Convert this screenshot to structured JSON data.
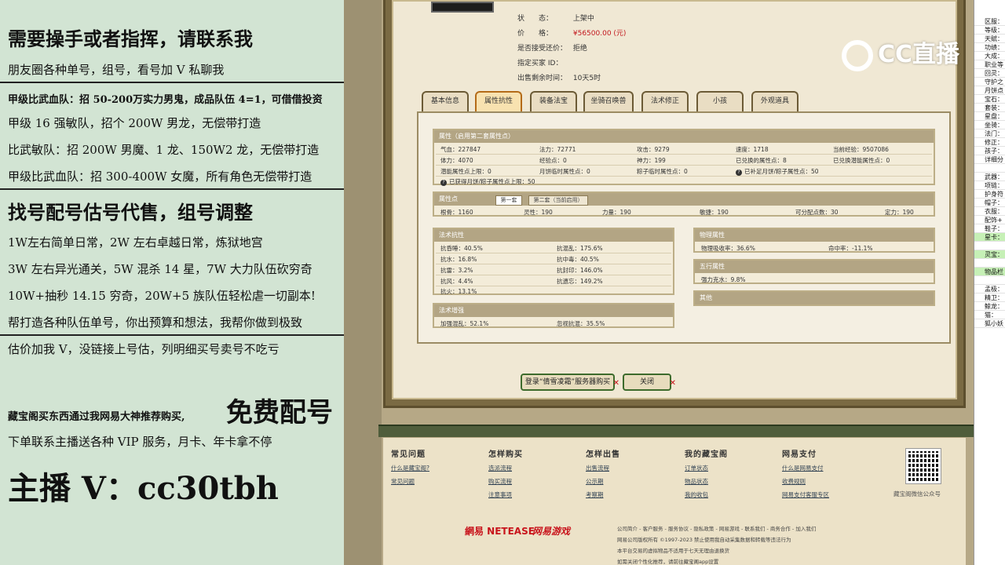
{
  "left_panel": {
    "lines": [
      "需要操手或者指挥，请联系我",
      "朋友圈各种单号，组号，看号加 V 私聊我",
      "甲级比武血队：招 50-200万实力男鬼，成品队伍 4=1，可借借投资",
      "甲级 16 强敏队，招个 200W 男龙，无偿带打造",
      "比武敏队：招 200W 男魔、1 龙、150W2 龙，无偿带打造",
      "甲级比武血队：招 300-400W 女魔，所有角色无偿带打造",
      "找号配号估号代售，组号调整",
      "1W左右简单日常，2W 左右卓越日常，炼狱地宫",
      "3W 左右异光通关，5W 混杀 14 星，7W 大力队伍砍穷奇",
      "10W+抽秒 14.15 穷奇，20W+5 族队伍轻松虐一切副本!",
      "帮打造各种队伍单号，你出预算和想法，我帮你做到极致",
      "估价加我 V，没链接上号估，列明细买号卖号不吃亏",
      "藏宝阁买东西通过我网易大神推荐购买,",
      "免费配号",
      "下单联系主播送各种 VIP 服务，月卡、年卡拿不停",
      "主播 V：cc30tbh"
    ]
  },
  "listing": {
    "status_label": "状　　态：",
    "status_value": "上架中",
    "price_label": "价　　格：",
    "price_value": "¥56500.00 (元)",
    "bargain_label": "是否接受还价：",
    "bargain_value": "拒绝",
    "buyer_label": "指定买家 ID：",
    "remain_label": "出售剩余时间：",
    "remain_value": "10天5时"
  },
  "tabs": [
    "基本信息",
    "属性抗性",
    "装备法宝",
    "坐骑召唤兽",
    "法术修正",
    "小孩",
    "外观道具"
  ],
  "attr": {
    "header": "属性（启用第二套属性点）",
    "row1": [
      "气血：227847",
      "法力：72771",
      "攻击：9279",
      "速度：1718",
      "当前经验：9507086"
    ],
    "row2": [
      "体力：4070",
      "经验点：0",
      "神力：199",
      "已兑换的属性点：8",
      "已兑换潜能属性点：0"
    ],
    "row3": [
      "潜能属性点上限：0",
      "月饼临时属性点：0",
      "粽子临时属性点：0",
      "已补足月饼/粽子属性点：50"
    ],
    "row4": "已获得月饼/粽子属性点上限：50"
  },
  "points": {
    "header": "属性点",
    "subtab1": "第一套",
    "subtab2": "第二套（当前启用）",
    "values": [
      "根骨：1160",
      "灵性：190",
      "力量：190",
      "敏捷：190",
      "可分配点数：30",
      "定力：190"
    ]
  },
  "resist": {
    "header": "法术抗性",
    "left": [
      "抗昏睡：40.5%",
      "抗水：16.8%",
      "抗雷：3.2%",
      "抗风：4.4%",
      "抗火：13.1%"
    ],
    "right": [
      "抗混乱：175.6%",
      "抗中毒：40.5%",
      "抗封印：146.0%",
      "抗遗忘：149.2%"
    ]
  },
  "enhance": {
    "header": "法术增强",
    "values": [
      "加强混乱：52.1%",
      "忽视抗混：35.5%"
    ]
  },
  "physical": {
    "header": "物理属性",
    "values": [
      "物理吸收率：36.6%",
      "命中率：-11.1%"
    ]
  },
  "wuxing": {
    "header": "五行属性",
    "values": [
      "强力克水：9.8%"
    ]
  },
  "other": {
    "header": "其他"
  },
  "buttons": {
    "login_buy": "登录“倩雪凌霜”服务器购买",
    "close": "关闭"
  },
  "footer": {
    "cols": [
      {
        "title": "常见问题",
        "links": [
          "什么是藏宝阁?",
          "常见问题"
        ]
      },
      {
        "title": "怎样购买",
        "links": [
          "选派流程",
          "购买流程",
          "注意事项"
        ]
      },
      {
        "title": "怎样出售",
        "links": [
          "出售流程",
          "公示期",
          "考察期"
        ]
      },
      {
        "title": "我的藏宝阁",
        "links": [
          "订单状态",
          "物品状态",
          "我的收包"
        ]
      },
      {
        "title": "网易支付",
        "links": [
          "什么是网易支付",
          "收费规则",
          "网易支付客服专区"
        ]
      }
    ],
    "qr_caption": "藏宝阁微信公众号",
    "logo_netease": "網易 NETEASE",
    "logo_games": "网易游戏",
    "copy": [
      "公司简介 - 客户服务 - 服务协议 - 隐私政策 - 网易游戏 - 联系我们 - 商务合作 - 加入我们",
      "网易公司版权所有 ©1997-2023 禁止使用我自动采集数据和转载等违法行为",
      "本平台交易的虚拟物品不适用于七天无理由退换货",
      "如需关闭个性化推荐，请前往藏宝阁app设置"
    ]
  },
  "watermark": "CC直播",
  "sheet_rows": [
    "区服：",
    "等级：",
    "天赋：",
    "功绩：",
    "大成：",
    "职业等",
    "回灵：",
    "守护之",
    "月饼点",
    "宝石：",
    "套装：",
    "星盘：",
    "坐骑：",
    "法门：",
    "修正：",
    "孩子：",
    "详细分",
    "",
    "武器：",
    "项链：",
    "护身符",
    "帽子：",
    "衣服：",
    "配饰+",
    "鞋子：",
    "星卡：",
    "",
    "灵宝：",
    "",
    "物品栏",
    "",
    "孟极：",
    "精卫：",
    "鲸龙：",
    "猫：",
    "狐小妖"
  ]
}
